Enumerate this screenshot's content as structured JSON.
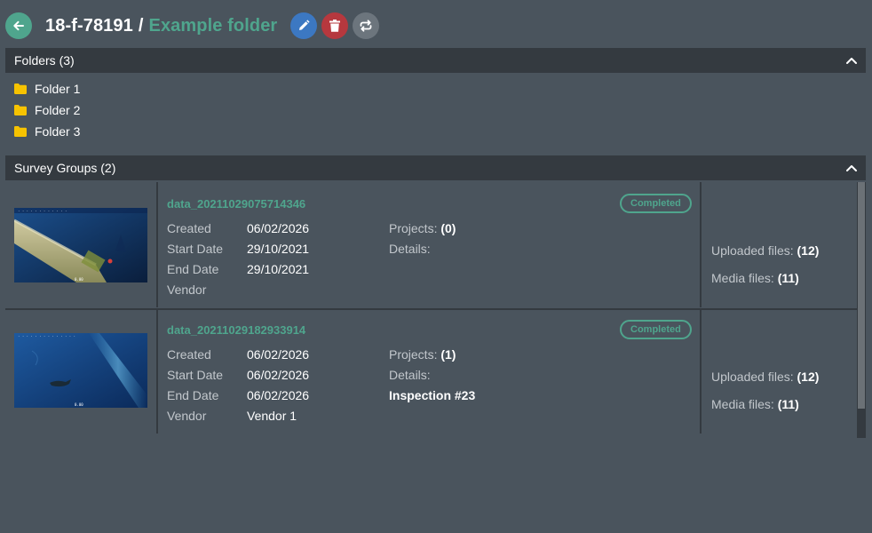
{
  "header": {
    "code": "18-f-78191",
    "separator": "/",
    "folder_name": "Example folder"
  },
  "icons": {
    "back": "arrow-left-icon",
    "edit": "pencil-icon",
    "delete": "trash-icon",
    "sync": "repeat-icon",
    "collapse": "chevron-up-icon",
    "folder": "folder-icon"
  },
  "colors": {
    "background": "#4a545d",
    "bar": "#343a40",
    "accent": "#4fa58d",
    "edit": "#3c78c2",
    "delete": "#b6383e",
    "sync": "#6c757d",
    "folder": "#f7c300"
  },
  "folders": {
    "title": "Folders (3)",
    "items": [
      {
        "label": "Folder 1"
      },
      {
        "label": "Folder 2"
      },
      {
        "label": "Folder 3"
      }
    ]
  },
  "survey_groups": {
    "title": "Survey Groups (2)",
    "labels": {
      "created": "Created",
      "start_date": "Start Date",
      "end_date": "End Date",
      "vendor": "Vendor",
      "projects": "Projects:",
      "details": "Details:",
      "uploaded_files": "Uploaded files:",
      "media_files": "Media files:"
    },
    "items": [
      {
        "name": "data_20211029075714346",
        "status": "Completed",
        "created": "06/02/2026",
        "start_date": "29/10/2021",
        "end_date": "29/10/2021",
        "vendor": "",
        "projects": "(0)",
        "details": "",
        "uploaded_files": "(12)",
        "media_files": "(11)"
      },
      {
        "name": "data_20211029182933914",
        "status": "Completed",
        "created": "06/02/2026",
        "start_date": "06/02/2026",
        "end_date": "06/02/2026",
        "vendor": "Vendor 1",
        "projects": "(1)",
        "details": "Inspection #23",
        "uploaded_files": "(12)",
        "media_files": "(11)"
      }
    ]
  }
}
